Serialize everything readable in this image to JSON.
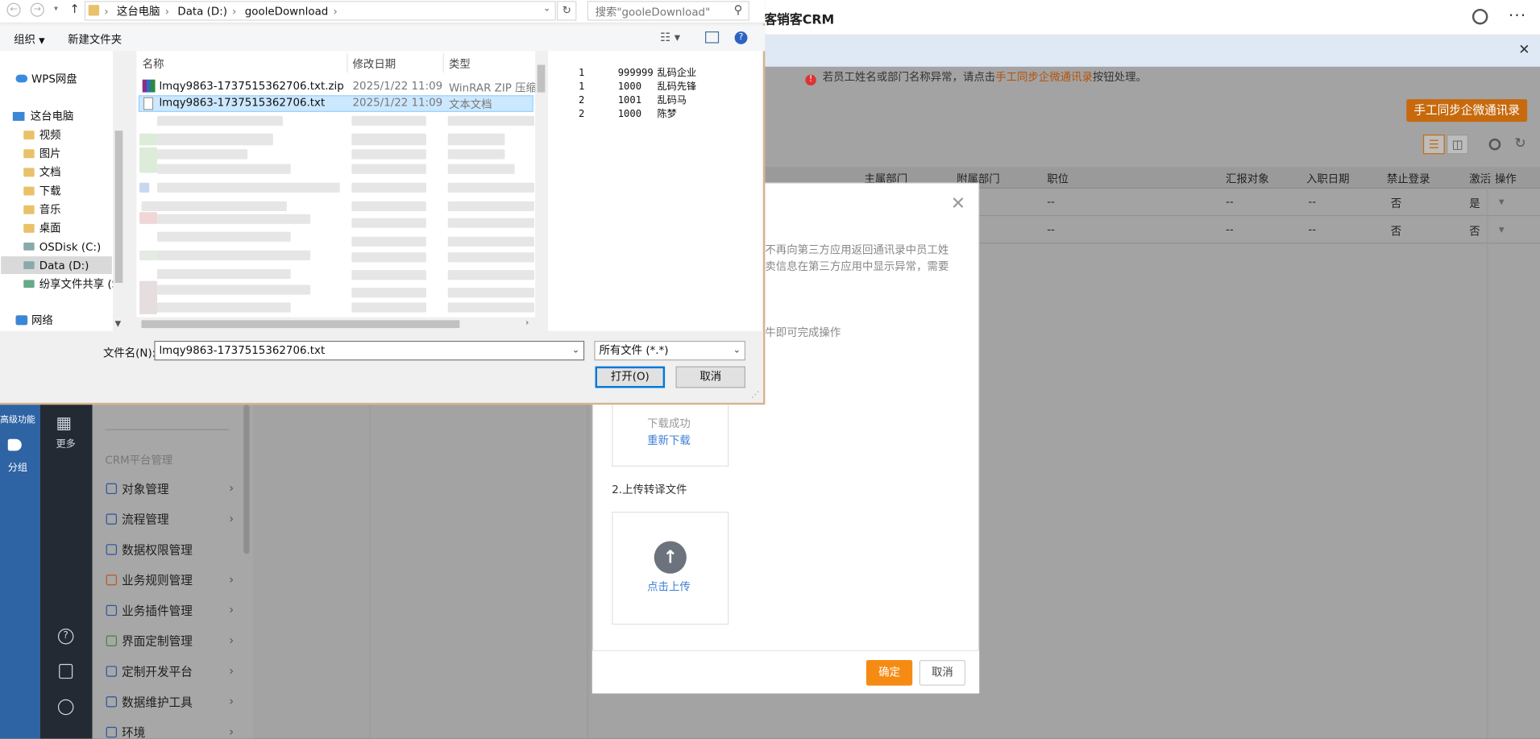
{
  "crm": {
    "app_title": "客销客CRM",
    "warning_prefix": "若员工姓名或部门名称异常，请点击",
    "warning_link": "手工同步企微通讯录",
    "warning_suffix": "按钮处理。",
    "sync_button": "手工同步企微通讯录",
    "table_headers": [
      "主属部门",
      "附属部门",
      "职位",
      "汇报对象",
      "入职日期",
      "禁止登录",
      "激活",
      "操作"
    ],
    "rows": [
      {
        "position": "--",
        "report_to": "--",
        "join_date": "--",
        "login_disabled": "否",
        "active": "是"
      },
      {
        "position": "--",
        "report_to": "--",
        "join_date": "--",
        "login_disabled": "否",
        "active": "否"
      }
    ],
    "left_nav": {
      "advanced": "高级功能",
      "group": "分组",
      "more": "更多"
    },
    "menu": {
      "section": "CRM平台管理",
      "items": [
        "对象管理",
        "流程管理",
        "数据权限管理",
        "业务规则管理",
        "业务插件管理",
        "界面定制管理",
        "定制开发平台",
        "数据维护工具",
        "环境"
      ]
    }
  },
  "modal": {
    "desc_line1": "不再向第三方应用返回通讯录中员工姓",
    "desc_line2": "卖信息在第三方应用中显示异常，需要",
    "step_hint": "牛即可完成操作",
    "download_status": "下载成功",
    "redownload": "重新下载",
    "step2_title": "2.上传转译文件",
    "upload_label": "点击上传",
    "ok": "确定",
    "cancel": "取消"
  },
  "dialog": {
    "breadcrumb": [
      "这台电脑",
      "Data (D:)",
      "gooleDownload"
    ],
    "search_placeholder": "搜索\"gooleDownload\"",
    "toolbar": {
      "organize": "组织",
      "new_folder": "新建文件夹"
    },
    "tree": [
      {
        "label": "WPS网盘",
        "icon": "cloud-icon"
      },
      {
        "label": "这台电脑",
        "icon": "computer-icon"
      },
      {
        "label": "视频",
        "icon": "folder-icon"
      },
      {
        "label": "图片",
        "icon": "folder-icon"
      },
      {
        "label": "文档",
        "icon": "folder-icon"
      },
      {
        "label": "下载",
        "icon": "folder-icon"
      },
      {
        "label": "音乐",
        "icon": "folder-icon"
      },
      {
        "label": "桌面",
        "icon": "folder-icon"
      },
      {
        "label": "OSDisk (C:)",
        "icon": "drive-icon"
      },
      {
        "label": "Data (D:)",
        "icon": "drive-icon"
      },
      {
        "label": "纷享文件共享 (S:",
        "icon": "network-drive-icon"
      },
      {
        "label": "网络",
        "icon": "network-icon"
      }
    ],
    "columns": {
      "name": "名称",
      "date": "修改日期",
      "type": "类型"
    },
    "files": [
      {
        "name": "lmqy9863-1737515362706.txt.zip",
        "date": "2025/1/22 11:09",
        "type": "WinRAR ZIP 压缩..."
      },
      {
        "name": "lmqy9863-1737515362706.txt",
        "date": "2025/1/22 11:09",
        "type": "文本文档"
      }
    ],
    "preview_lines": [
      {
        "c1": "1",
        "c2": "999999",
        "c3": "乱码企业"
      },
      {
        "c1": "1",
        "c2": "1000",
        "c3": "乱码先锋"
      },
      {
        "c1": "2",
        "c2": "1001",
        "c3": "乱码马"
      },
      {
        "c1": "2",
        "c2": "1000",
        "c3": "陈梦"
      }
    ],
    "filename_label": "文件名(N):",
    "filename_value": "lmqy9863-1737515362706.txt",
    "filter": "所有文件 (*.*)",
    "open": "打开(O)",
    "cancel": "取消"
  }
}
